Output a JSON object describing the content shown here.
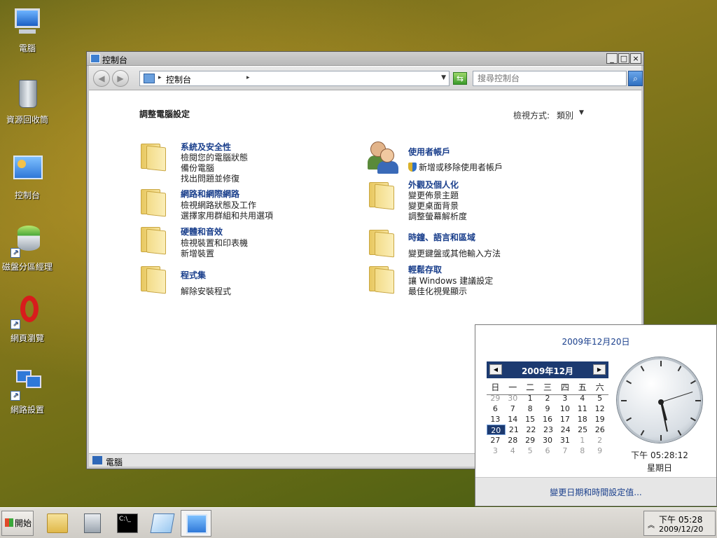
{
  "desktop": {
    "icons": [
      {
        "name": "desktop-icon-computer",
        "label": "電腦"
      },
      {
        "name": "desktop-icon-recycle-bin",
        "label": "資源回收筒"
      },
      {
        "name": "desktop-icon-control-panel",
        "label": "控制台"
      },
      {
        "name": "desktop-icon-disk-management",
        "label": "磁盤分區經理"
      },
      {
        "name": "desktop-icon-web-browser",
        "label": "網頁瀏覽"
      },
      {
        "name": "desktop-icon-network-settings",
        "label": "網路設置"
      }
    ]
  },
  "window": {
    "title": "控制台",
    "buttons": {
      "minimize": "_",
      "maximize": "□",
      "close": "×"
    },
    "address": "控制台",
    "search_placeholder": "搜尋控制台",
    "heading": "調整電腦設定",
    "view_by_label": "檢視方式:",
    "view_by_value": "類別",
    "categories": {
      "system_security": {
        "title": "系統及安全性",
        "links": [
          "檢閱您的電腦狀態",
          "備份電腦",
          "找出問題並修復"
        ]
      },
      "network": {
        "title": "網路和網際網路",
        "links": [
          "檢視網路狀態及工作",
          "選擇家用群組和共用選項"
        ]
      },
      "hardware": {
        "title": "硬體和音效",
        "links": [
          "檢視裝置和印表機",
          "新增裝置"
        ]
      },
      "programs": {
        "title": "程式集",
        "links": [
          "解除安裝程式"
        ]
      },
      "user_accounts": {
        "title": "使用者帳戶",
        "links": [
          "新增或移除使用者帳戶"
        ]
      },
      "appearance": {
        "title": "外觀及個人化",
        "links": [
          "變更佈景主題",
          "變更桌面背景",
          "調整螢幕解析度"
        ]
      },
      "clock_region": {
        "title": "時鐘、語言和區域",
        "links": [
          "變更鍵盤或其他輸入方法"
        ]
      },
      "ease_access": {
        "title": "輕鬆存取",
        "links": [
          "讓 Windows 建議設定",
          "最佳化視覺顯示"
        ]
      }
    },
    "status_text": "電腦"
  },
  "calendar": {
    "full_date": "2009年12月20日",
    "month_label": "2009年12月",
    "weekdays": [
      "日",
      "一",
      "二",
      "三",
      "四",
      "五",
      "六"
    ],
    "weeks": [
      [
        "29",
        "30",
        "1",
        "2",
        "3",
        "4",
        "5"
      ],
      [
        "6",
        "7",
        "8",
        "9",
        "10",
        "11",
        "12"
      ],
      [
        "13",
        "14",
        "15",
        "16",
        "17",
        "18",
        "19"
      ],
      [
        "20",
        "21",
        "22",
        "23",
        "24",
        "25",
        "26"
      ],
      [
        "27",
        "28",
        "29",
        "30",
        "31",
        "1",
        "2"
      ],
      [
        "3",
        "4",
        "5",
        "6",
        "7",
        "8",
        "9"
      ]
    ],
    "selected_day": "20",
    "time": "下午 05:28:12",
    "weekday": "星期日",
    "change_link": "變更日期和時間設定值..."
  },
  "taskbar": {
    "start_label": "開始",
    "clock_time": "下午 05:28",
    "clock_date": "2009/12/20",
    "tray_chevron": "︽"
  },
  "colors": {
    "link_blue": "#1a3f8c",
    "calendar_header": "#1c3a70"
  }
}
